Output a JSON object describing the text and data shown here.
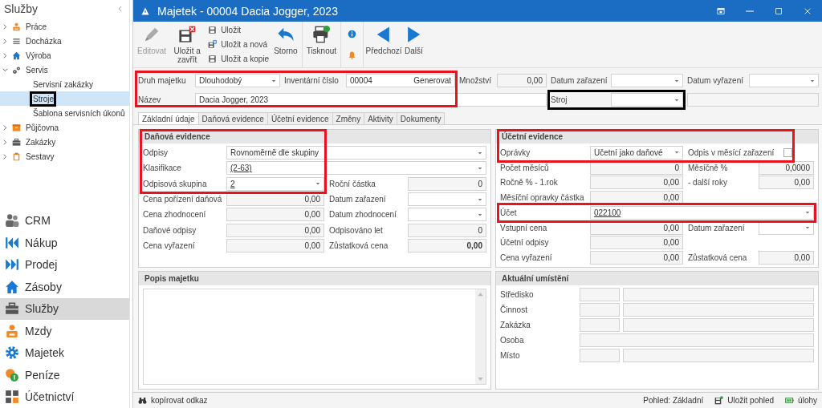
{
  "sidebar": {
    "title": "Služby",
    "tree": [
      {
        "label": "Práce",
        "expanded": false
      },
      {
        "label": "Docházka",
        "expanded": false
      },
      {
        "label": "Výroba",
        "expanded": false
      },
      {
        "label": "Servis",
        "expanded": true,
        "children": [
          {
            "label": "Servisní zakázky",
            "selected": false
          },
          {
            "label": "Stroje",
            "selected": true,
            "color": "#000000"
          },
          {
            "label": "Šablona servisních úkonů",
            "selected": false
          }
        ]
      },
      {
        "label": "Půjčovna",
        "expanded": false
      },
      {
        "label": "Zakázky",
        "expanded": false
      },
      {
        "label": "Sestavy",
        "expanded": false
      }
    ],
    "modules": [
      {
        "label": "CRM",
        "selected": false
      },
      {
        "label": "Nákup",
        "selected": false
      },
      {
        "label": "Prodej",
        "selected": false
      },
      {
        "label": "Zásoby",
        "selected": false
      },
      {
        "label": "Služby",
        "selected": true
      },
      {
        "label": "Mzdy",
        "selected": false
      },
      {
        "label": "Majetek",
        "selected": false
      },
      {
        "label": "Peníze",
        "selected": false
      },
      {
        "label": "Účetnictví",
        "selected": false
      }
    ]
  },
  "window": {
    "title": "Majetek - 00004 Dacia Jogger, 2023"
  },
  "toolbar": [
    [
      {
        "kind": "large",
        "label": "Editovat",
        "disabled": true
      },
      {
        "kind": "large",
        "label": "Uložit a zavřít",
        "disabled": false
      },
      {
        "kind": "stack",
        "items": [
          {
            "label": "Uložit"
          },
          {
            "label": "Uložit a nová"
          },
          {
            "label": "Uložit a kopie"
          }
        ]
      },
      {
        "kind": "large",
        "label": "Storno",
        "disabled": false
      }
    ],
    [
      {
        "kind": "large",
        "label": "Tisknout",
        "disabled": false
      }
    ],
    [
      {
        "kind": "icons"
      }
    ],
    [
      {
        "kind": "large",
        "label": "Předchozí",
        "disabled": false
      },
      {
        "kind": "large",
        "label": "Další",
        "disabled": false
      }
    ]
  ],
  "header": [
    [
      {
        "label": "Druh majetku",
        "kind": "select",
        "value": "Dlouhodobý",
        "color": "#e8131f"
      },
      {
        "label": "Inventární číslo",
        "kind": "input",
        "value": "00004",
        "action": "Generovat",
        "color": "#e8131f"
      },
      {
        "label": "Množství",
        "kind": "number",
        "value": "0,00"
      },
      {
        "label": "Datum zařazení",
        "kind": "select"
      },
      {
        "label": "Datum vyřazení",
        "kind": "select"
      }
    ],
    [
      {
        "label": "Název",
        "kind": "input",
        "value": "Dacia Jogger, 2023",
        "wide": true,
        "color": "#e8131f"
      },
      {
        "label": "Stroj",
        "kind": "select",
        "color": "#000000"
      },
      {
        "kind": "readonly",
        "wide": true
      }
    ]
  ],
  "tabs": [
    {
      "label": "Základní údaje",
      "selected": true
    },
    {
      "label": "Daňová evidence",
      "selected": false
    },
    {
      "label": "Účetní evidence",
      "selected": false
    },
    {
      "label": "Změny",
      "selected": false
    },
    {
      "label": "Aktivity",
      "selected": false
    },
    {
      "label": "Dokumenty",
      "selected": false
    }
  ],
  "tax_panel": {
    "title": "Daňová evidence",
    "color": "#e8131f",
    "rows": [
      [
        {
          "label": "Odpisy",
          "kind": "select",
          "value": "Rovnoměrně dle skupiny",
          "wide": true,
          "color": "#e8131f"
        }
      ],
      [
        {
          "label": "Klasifikace",
          "kind": "select",
          "value": "(2-63)",
          "link": true,
          "wide": true,
          "color": "#e8131f"
        }
      ],
      [
        {
          "label": "Odpisová skupina",
          "kind": "select",
          "value": "2",
          "link": true,
          "color": "#e8131f"
        },
        {
          "label": "Roční částka",
          "kind": "number",
          "value": "0"
        }
      ],
      [
        {
          "label": "Cena pořízení daňová",
          "kind": "number",
          "value": "0,00"
        },
        {
          "label": "Datum zařazení",
          "kind": "select"
        }
      ],
      [
        {
          "label": "Cena zhodnocení",
          "kind": "number",
          "value": "0,00"
        },
        {
          "label": "Datum zhodnocení",
          "kind": "select"
        }
      ],
      [
        {
          "label": "Daňové odpisy",
          "kind": "number",
          "value": "0,00"
        },
        {
          "label": "Odpisováno let",
          "kind": "number",
          "value": "0"
        }
      ],
      [
        {
          "label": "Cena vyřazení",
          "kind": "number",
          "value": "0,00"
        },
        {
          "label": "Zůstatková cena",
          "kind": "number",
          "value": "0,00",
          "bold": true
        }
      ]
    ]
  },
  "accounting_panel": {
    "title": "Účetní evidence",
    "color": "#e8131f",
    "rows": [
      [
        {
          "label": "Oprávky",
          "kind": "select",
          "value": "Účetní jako daňové",
          "color": "#e8131f"
        },
        {
          "label": "Odpis v měsící zařazení",
          "kind": "checkbox",
          "checked": false,
          "color": "#e8131f"
        }
      ],
      [
        {
          "label": "Počet měsíců",
          "kind": "number",
          "value": "0"
        },
        {
          "label": "Měsíčně %",
          "kind": "number",
          "value": "0,0000"
        }
      ],
      [
        {
          "label": "Ročně % - 1.rok",
          "kind": "number",
          "value": "0,00"
        },
        {
          "label": "- další roky",
          "kind": "number",
          "value": "0,00"
        }
      ],
      [
        {
          "label": "Měsíční opravky částka",
          "kind": "number",
          "value": "0,00"
        }
      ],
      [
        {
          "label": "Účet",
          "kind": "select",
          "value": "022100",
          "link": true,
          "wide": true,
          "color": "#e8131f"
        }
      ],
      [
        {
          "label": "Vstupní cena",
          "kind": "number",
          "value": "0,00"
        },
        {
          "label": "Datum zařazení",
          "kind": "select"
        }
      ],
      [
        {
          "label": "Účetní odpisy",
          "kind": "number",
          "value": "0,00"
        }
      ],
      [
        {
          "label": "Cena vyřazení",
          "kind": "number",
          "value": "0,00"
        },
        {
          "label": "Zůstatková cena",
          "kind": "number",
          "value": "0,00",
          "bold": false
        }
      ]
    ]
  },
  "description_panel": {
    "title": "Popis majetku"
  },
  "location_panel": {
    "title": "Aktuální umístění",
    "rows": [
      {
        "label": "Středisko",
        "kind": "pair"
      },
      {
        "label": "Činnost",
        "kind": "pair"
      },
      {
        "label": "Zakázka",
        "kind": "pair"
      },
      {
        "label": "Osoba",
        "kind": "single"
      },
      {
        "label": "Místo",
        "kind": "pair"
      }
    ]
  },
  "status_bar": {
    "left": [
      {
        "label": "kopírovat odkaz",
        "kind": "button"
      }
    ],
    "right": [
      {
        "label": "Pohled: Základní",
        "kind": "text"
      },
      {
        "label": "Uložit pohled",
        "kind": "button"
      },
      {
        "label": "úlohy",
        "kind": "button"
      }
    ]
  }
}
